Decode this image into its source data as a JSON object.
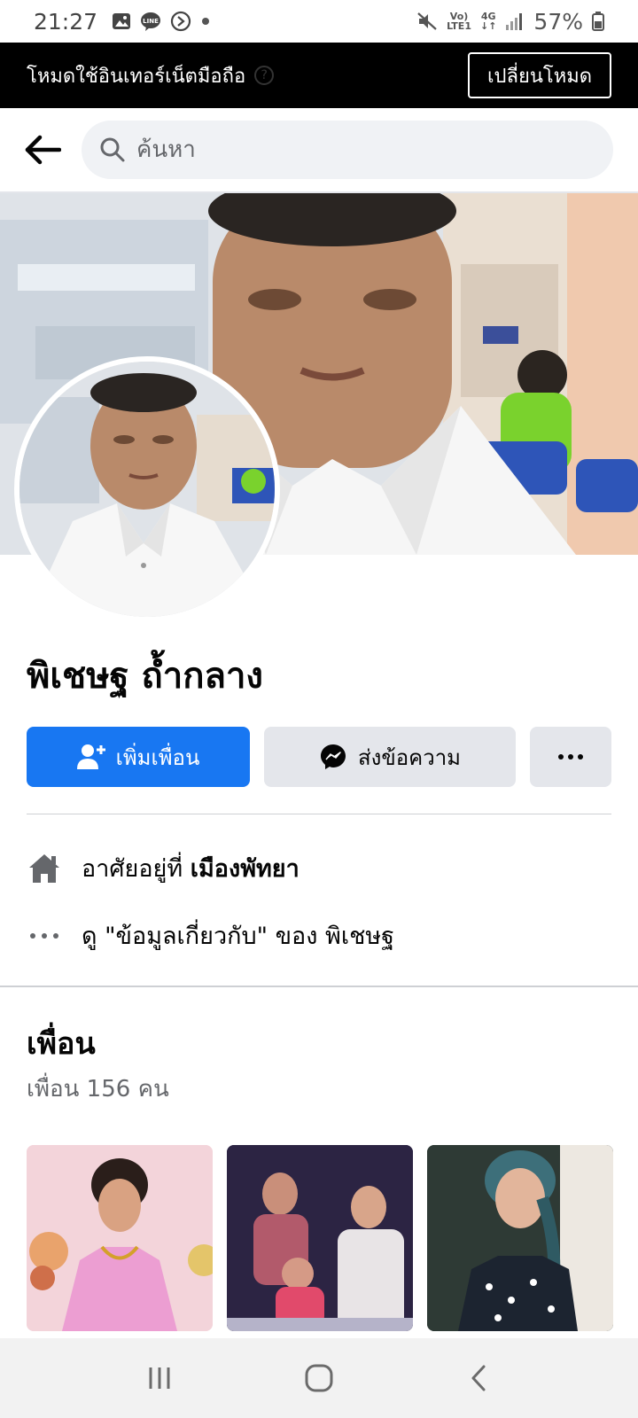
{
  "status_bar": {
    "time": "21:27",
    "network_volte": "Vo)",
    "network_lte": "LTE1",
    "network_4g": "4G",
    "battery": "57%",
    "icons": [
      "image-icon",
      "line-app-icon",
      "data-saver-icon",
      "dot-icon",
      "mute-icon",
      "signal-icon",
      "battery-icon"
    ]
  },
  "mode_banner": {
    "text": "โหมดใช้อินเทอร์เน็ตมือถือ",
    "help": "?",
    "button_label": "เปลี่ยนโหมด"
  },
  "header": {
    "search_placeholder": "ค้นหา"
  },
  "profile": {
    "name": "พิเชษฐ ถ้ำกลาง",
    "add_friend_label": "เพิ่มเพื่อน",
    "message_label": "ส่งข้อความ",
    "more_label": "···"
  },
  "info": {
    "lives_prefix": "อาศัยอยู่ที่",
    "lives_place": "เมืองพัทยา",
    "about_text": "ดู \"ข้อมูลเกี่ยวกับ\" ของ พิเชษฐ"
  },
  "friends": {
    "title": "เพื่อน",
    "count": "เพื่อน 156 คน"
  },
  "colors": {
    "accent": "#1877f2",
    "button_gray": "#e4e6eb",
    "secondary_text": "#65676b",
    "banner_bg": "#000000"
  }
}
